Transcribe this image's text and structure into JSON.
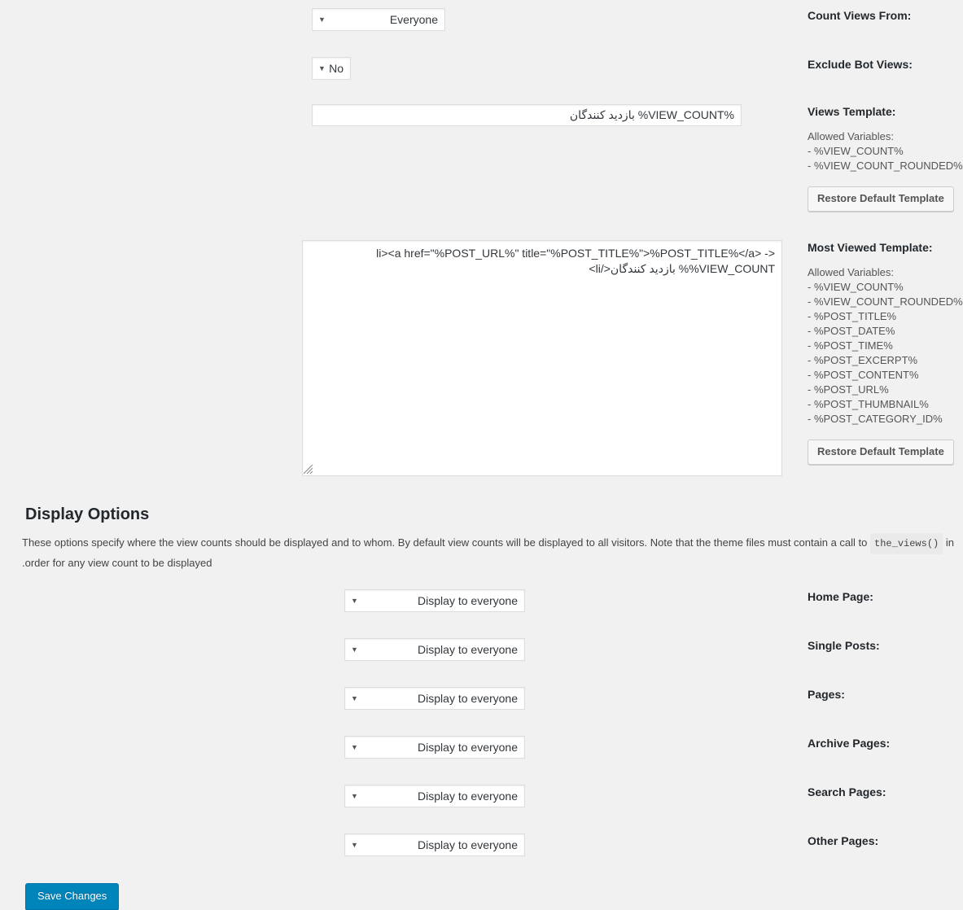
{
  "settings": {
    "count_views_from": {
      "label": ":Count Views From",
      "value": "Everyone",
      "arrow": "▼"
    },
    "exclude_bot_views": {
      "label": ":Exclude Bot Views",
      "value": "No",
      "arrow": "▼"
    },
    "views_template": {
      "label": ":Views Template",
      "allowed_title": ":Allowed Variables",
      "allowed": [
        "%VIEW_COUNT% -",
        "%VIEW_COUNT_ROUNDED% -"
      ],
      "restore_label": "Restore Default Template",
      "value": "%VIEW_COUNT% بازدید کنندگان"
    },
    "most_viewed_template": {
      "label": ":Most Viewed Template",
      "allowed_title": ":Allowed Variables",
      "allowed": [
        "%VIEW_COUNT% -",
        "%VIEW_COUNT_ROUNDED% -",
        "%POST_TITLE% -",
        "%POST_DATE% -",
        "%POST_TIME% -",
        "%POST_EXCERPT% -",
        "%POST_CONTENT% -",
        "%POST_URL% -",
        "%POST_THUMBNAIL% -",
        "%POST_CATEGORY_ID% -"
      ],
      "restore_label": "Restore Default Template",
      "value": "<li><a href=\"%POST_URL%\" title=\"%POST_TITLE%\">%POST_TITLE%</a> - %VIEW_COUNT% بازدید کنندگان</li>"
    }
  },
  "display_options": {
    "heading": "Display Options",
    "description_part1": "These options specify where the view counts should be displayed and to whom. By default view counts will be displayed to all visitors. Note that the theme files must contain a call to",
    "description_code": "the_views()",
    "description_part2": "in order for any view count to be displayed.",
    "rows": [
      {
        "label": ":Home Page",
        "value": "Display to everyone",
        "arrow": "▼"
      },
      {
        "label": ":Single Posts",
        "value": "Display to everyone",
        "arrow": "▼"
      },
      {
        "label": ":Pages",
        "value": "Display to everyone",
        "arrow": "▼"
      },
      {
        "label": ":Archive Pages",
        "value": "Display to everyone",
        "arrow": "▼"
      },
      {
        "label": ":Search Pages",
        "value": "Display to everyone",
        "arrow": "▼"
      },
      {
        "label": ":Other Pages",
        "value": "Display to everyone",
        "arrow": "▼"
      }
    ]
  },
  "footer": {
    "save_label": "Save Changes"
  },
  "colors": {
    "page_background": "#f1f1f1",
    "primary_button": "#0085ba",
    "label_text": "#23282d",
    "body_text": "#444444",
    "field_border": "#dddddd"
  }
}
